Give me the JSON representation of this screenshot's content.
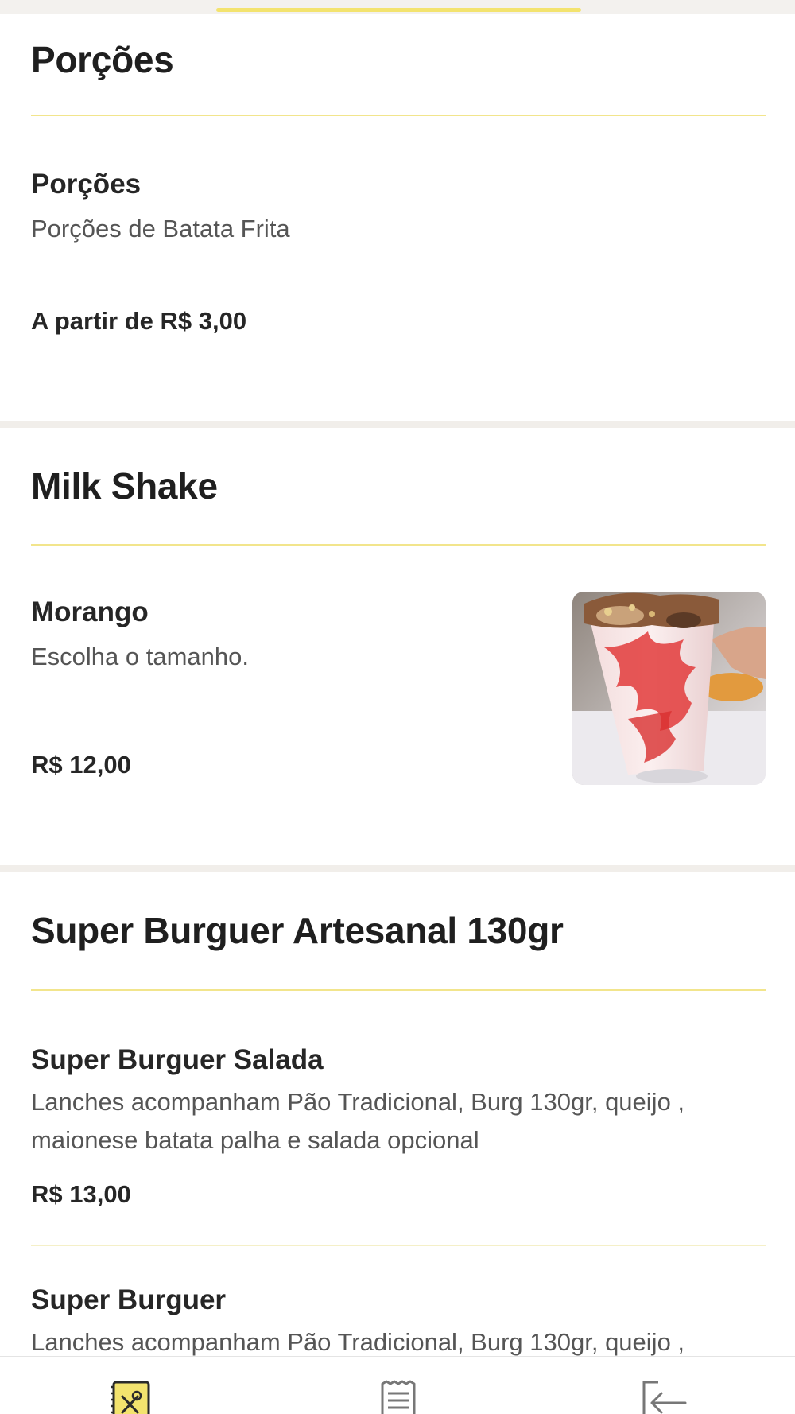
{
  "colors": {
    "accent_yellow": "#f3e36e",
    "section_gap": "#f1eeea",
    "text_dark": "#222222",
    "text_muted": "#555555"
  },
  "sections": [
    {
      "title": "Porções",
      "items": [
        {
          "name": "Porções",
          "description": "Porções de Batata Frita",
          "price": "A partir de R$ 3,00"
        }
      ]
    },
    {
      "title": "Milk Shake",
      "items": [
        {
          "name": "Morango",
          "description": "Escolha o tamanho.",
          "price": "R$ 12,00",
          "image": "strawberry-milkshake-photo"
        }
      ]
    },
    {
      "title": "Super Burguer Artesanal 130gr",
      "items": [
        {
          "name": "Super Burguer Salada",
          "description_line1": "Lanches acompanham Pão Tradicional, Burg 130gr, queijo ,",
          "description_line2": "maionese batata palha e salada opcional",
          "price": "R$ 13,00"
        },
        {
          "name": "Super Burguer",
          "description_line1": "Lanches acompanham Pão Tradicional, Burg 130gr, queijo ,"
        }
      ]
    }
  ],
  "bottom_nav": [
    {
      "icon": "menu-cutlery-icon",
      "active": true
    },
    {
      "icon": "receipt-icon",
      "active": false
    },
    {
      "icon": "logout-icon",
      "active": false
    }
  ]
}
